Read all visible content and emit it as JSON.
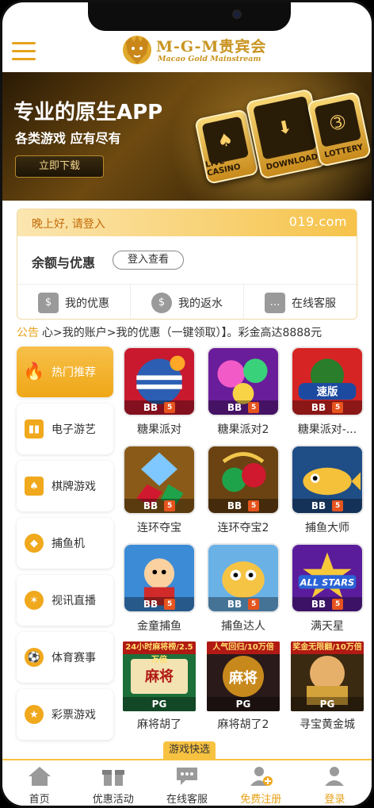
{
  "header": {
    "brand": "M-G-M贵宾会",
    "brand_sub": "Macao Gold Mainstream"
  },
  "banner": {
    "title": "专业的原生APP",
    "subtitle": "各类游戏 应有尽有",
    "button": "立即下载",
    "tiles": [
      "LIVE CASINO",
      "DOWNLOAD",
      "LOTTERY"
    ]
  },
  "welcome": {
    "greeting": "晚上好, 请登入",
    "domain": "019.com",
    "balance_label": "余额与优惠",
    "login_button": "登入查看",
    "actions": [
      {
        "label": "我的优惠",
        "icon": "promo-icon"
      },
      {
        "label": "我的返水",
        "icon": "rebate-icon"
      },
      {
        "label": "在线客服",
        "icon": "chat-icon"
      }
    ]
  },
  "notice": {
    "tag": "公告",
    "text": "心>我的账户>我的优惠（一键领取）】。彩金高达8888元"
  },
  "categories": [
    {
      "label": "热门推荐",
      "icon": "fire-icon"
    },
    {
      "label": "电子游艺",
      "icon": "slot-icon"
    },
    {
      "label": "棋牌游戏",
      "icon": "cards-icon"
    },
    {
      "label": "捕鱼机",
      "icon": "fish-icon"
    },
    {
      "label": "视讯直播",
      "icon": "live-icon"
    },
    {
      "label": "体育赛事",
      "icon": "soccer-icon"
    },
    {
      "label": "彩票游戏",
      "icon": "lottery-icon"
    }
  ],
  "games": [
    {
      "name": "糖果派对",
      "provider": "BB"
    },
    {
      "name": "糖果派对2",
      "provider": "BB"
    },
    {
      "name": "糖果派对-...",
      "provider": "BB"
    },
    {
      "name": "连环夺宝",
      "provider": "BB"
    },
    {
      "name": "连环夺宝2",
      "provider": "BB"
    },
    {
      "name": "捕鱼大师",
      "provider": "BB"
    },
    {
      "name": "金童捕鱼",
      "provider": "BB"
    },
    {
      "name": "捕鱼达人",
      "provider": "BB"
    },
    {
      "name": "满天星",
      "provider": "BB"
    },
    {
      "name": "麻将胡了",
      "provider": "PG",
      "strip": "24小时麻将榜/2.5万倍"
    },
    {
      "name": "麻将胡了2",
      "provider": "PG",
      "strip": "人气回归/10万倍"
    },
    {
      "name": "寻宝黄金城",
      "provider": "PG",
      "strip": "奖金无限翻/10万倍"
    }
  ],
  "quick": "游戏快选",
  "nav": [
    {
      "label": "首页",
      "icon": "home-icon"
    },
    {
      "label": "优惠活动",
      "icon": "gift-icon"
    },
    {
      "label": "在线客服",
      "icon": "chat-icon"
    },
    {
      "label": "免费注册",
      "icon": "register-icon"
    },
    {
      "label": "登录",
      "icon": "login-icon"
    }
  ],
  "colors": {
    "accent": "#f0a81c",
    "banner_dark": "#2a1a05",
    "text": "#333333"
  }
}
